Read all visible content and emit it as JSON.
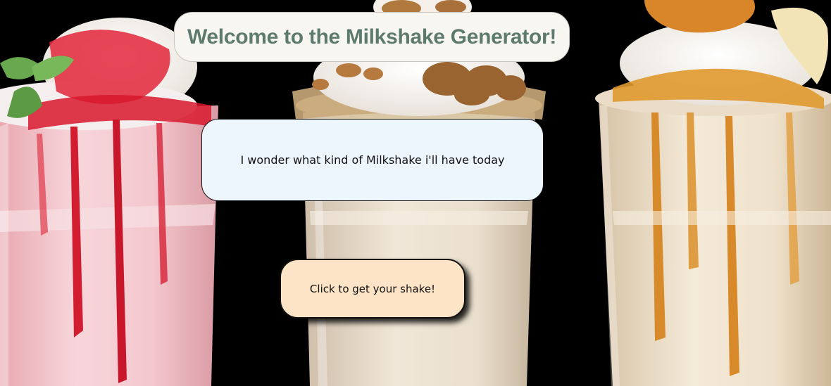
{
  "header": {
    "title": "Welcome to the Milkshake Generator!"
  },
  "message": {
    "text": "I wonder what kind of Milkshake i'll have today"
  },
  "action": {
    "button_label": "Click to get your shake!"
  },
  "colors": {
    "background": "#000000",
    "title_box": "#f8f6f1",
    "title_text": "#5d7a6f",
    "message_box": "#eef6fd",
    "button_box": "#fde4c6"
  },
  "background_image": {
    "icons": [
      "strawberry-milkshake-icon",
      "walnut-milkshake-icon",
      "caramel-banana-milkshake-icon"
    ]
  }
}
